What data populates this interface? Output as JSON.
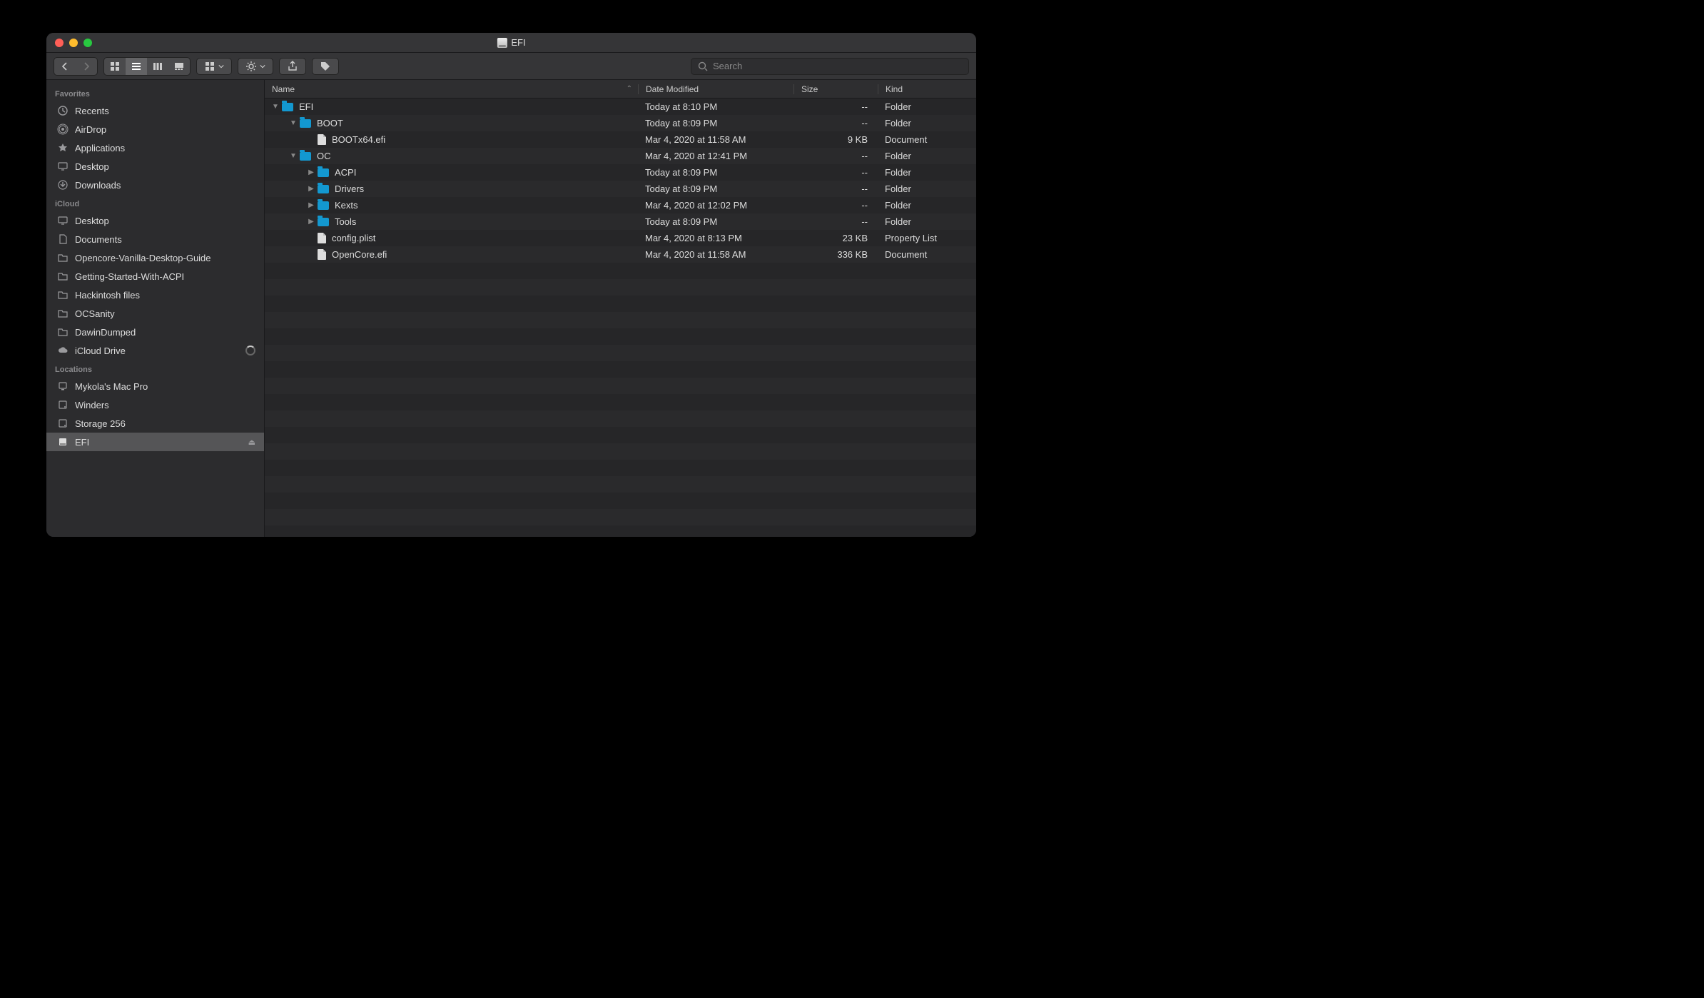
{
  "window": {
    "title": "EFI"
  },
  "search": {
    "placeholder": "Search"
  },
  "columns": {
    "name": "Name",
    "date": "Date Modified",
    "size": "Size",
    "kind": "Kind"
  },
  "sidebar": {
    "sections": [
      {
        "label": "Favorites",
        "items": [
          {
            "icon": "recents",
            "label": "Recents"
          },
          {
            "icon": "airdrop",
            "label": "AirDrop"
          },
          {
            "icon": "apps",
            "label": "Applications"
          },
          {
            "icon": "desktop",
            "label": "Desktop"
          },
          {
            "icon": "downloads",
            "label": "Downloads"
          }
        ]
      },
      {
        "label": "iCloud",
        "items": [
          {
            "icon": "desktop",
            "label": "Desktop"
          },
          {
            "icon": "documents",
            "label": "Documents"
          },
          {
            "icon": "folder",
            "label": "Opencore-Vanilla-Desktop-Guide"
          },
          {
            "icon": "folder",
            "label": "Getting-Started-With-ACPI"
          },
          {
            "icon": "folder",
            "label": "Hackintosh files"
          },
          {
            "icon": "folder",
            "label": "OCSanity"
          },
          {
            "icon": "folder",
            "label": "DawinDumped"
          },
          {
            "icon": "cloud",
            "label": "iCloud Drive",
            "loading": true
          }
        ]
      },
      {
        "label": "Locations",
        "items": [
          {
            "icon": "mac",
            "label": "Mykola's Mac Pro"
          },
          {
            "icon": "hdd",
            "label": "Winders"
          },
          {
            "icon": "hdd",
            "label": "Storage 256"
          },
          {
            "icon": "disk",
            "label": "EFI",
            "selected": true,
            "eject": true
          }
        ]
      }
    ]
  },
  "rows": [
    {
      "indent": 0,
      "twisty": "down",
      "type": "folder",
      "name": "EFI",
      "date": "Today at 8:10 PM",
      "size": "--",
      "kind": "Folder"
    },
    {
      "indent": 1,
      "twisty": "down",
      "type": "folder",
      "name": "BOOT",
      "date": "Today at 8:09 PM",
      "size": "--",
      "kind": "Folder"
    },
    {
      "indent": 2,
      "twisty": "",
      "type": "file",
      "name": "BOOTx64.efi",
      "date": "Mar 4, 2020 at 11:58 AM",
      "size": "9 KB",
      "kind": "Document"
    },
    {
      "indent": 1,
      "twisty": "down",
      "type": "folder",
      "name": "OC",
      "date": "Mar 4, 2020 at 12:41 PM",
      "size": "--",
      "kind": "Folder"
    },
    {
      "indent": 2,
      "twisty": "right",
      "type": "folder",
      "name": "ACPI",
      "date": "Today at 8:09 PM",
      "size": "--",
      "kind": "Folder"
    },
    {
      "indent": 2,
      "twisty": "right",
      "type": "folder",
      "name": "Drivers",
      "date": "Today at 8:09 PM",
      "size": "--",
      "kind": "Folder"
    },
    {
      "indent": 2,
      "twisty": "right",
      "type": "folder",
      "name": "Kexts",
      "date": "Mar 4, 2020 at 12:02 PM",
      "size": "--",
      "kind": "Folder"
    },
    {
      "indent": 2,
      "twisty": "right",
      "type": "folder",
      "name": "Tools",
      "date": "Today at 8:09 PM",
      "size": "--",
      "kind": "Folder"
    },
    {
      "indent": 2,
      "twisty": "",
      "type": "file",
      "name": "config.plist",
      "date": "Mar 4, 2020 at 8:13 PM",
      "size": "23 KB",
      "kind": "Property List"
    },
    {
      "indent": 2,
      "twisty": "",
      "type": "file",
      "name": "OpenCore.efi",
      "date": "Mar 4, 2020 at 11:58 AM",
      "size": "336 KB",
      "kind": "Document"
    }
  ]
}
